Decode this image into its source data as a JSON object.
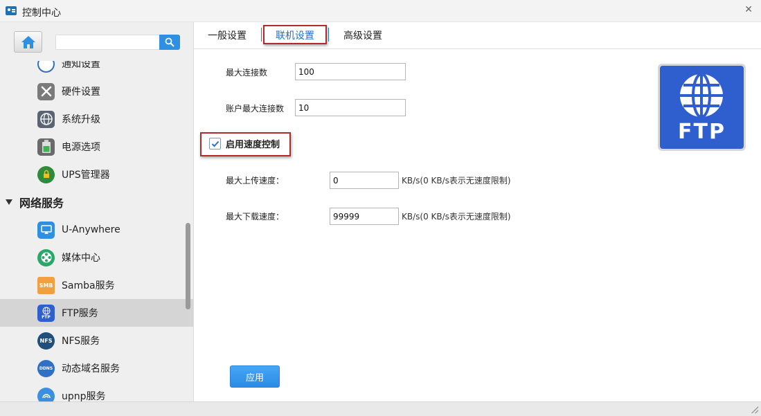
{
  "window": {
    "title": "控制中心",
    "close_glyph": "✕"
  },
  "sidebar": {
    "search_placeholder": "",
    "search_value": "",
    "items": [
      {
        "label": "通知设置",
        "icon": "bell-settings-icon"
      },
      {
        "label": "硬件设置",
        "icon": "tools-icon"
      },
      {
        "label": "系统升级",
        "icon": "globe-upgrade-icon"
      },
      {
        "label": "电源选项",
        "icon": "battery-icon"
      },
      {
        "label": "UPS管理器",
        "icon": "ups-power-icon"
      }
    ],
    "group": {
      "label": "网络服务"
    },
    "network_items": [
      {
        "label": "U-Anywhere",
        "icon": "monitor-icon"
      },
      {
        "label": "媒体中心",
        "icon": "film-reel-icon"
      },
      {
        "label": "Samba服务",
        "icon": "smb-folder-icon",
        "badge": "SMB"
      },
      {
        "label": "FTP服务",
        "icon": "ftp-globe-icon",
        "badge": "FTP",
        "selected": true
      },
      {
        "label": "NFS服务",
        "icon": "nfs-icon",
        "badge": "NFS"
      },
      {
        "label": "动态域名服务",
        "icon": "ddns-icon",
        "badge": "DDNS"
      },
      {
        "label": "upnp服务",
        "icon": "upnp-icon"
      }
    ]
  },
  "tabs": [
    {
      "label": "一般设置",
      "active": false
    },
    {
      "label": "联机设置",
      "active": true
    },
    {
      "label": "高级设置",
      "active": false
    }
  ],
  "form": {
    "max_connections_label": "最大连接数",
    "max_connections_value": "100",
    "account_max_connections_label": "账户最大连接数",
    "account_max_connections_value": "10",
    "speed_control_label": "启用速度控制",
    "speed_control_checked": true,
    "max_upload_label": "最大上传速度：",
    "max_upload_value": "0",
    "max_upload_hint": "KB/s(0 KB/s表示无速度限制)",
    "max_download_label": "最大下载速度：",
    "max_download_value": "99999",
    "max_download_hint": "KB/s(0 KB/s表示无速度限制)"
  },
  "logo": {
    "text": "FTP"
  },
  "apply_button": "应用",
  "colors": {
    "accent": "#2f8fe0",
    "highlight_border": "#b22a2a",
    "ftp_blue": "#2f5fcf",
    "selected_row": "#d5d5d5"
  }
}
